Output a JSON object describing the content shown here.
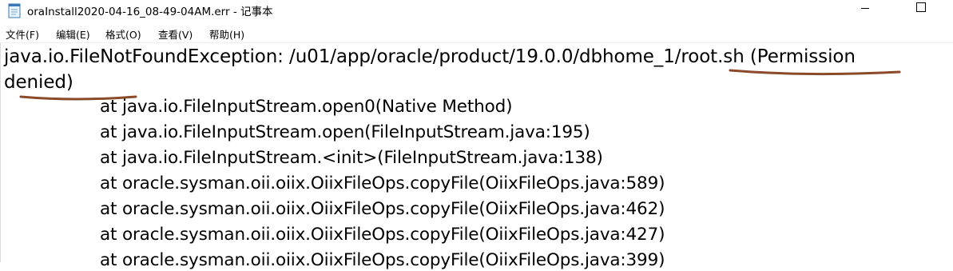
{
  "window": {
    "title": "oraInstall2020-04-16_08-49-04AM.err - 记事本",
    "icon": "notepad-file-icon"
  },
  "menu": {
    "file": "文件(F)",
    "edit": "编辑(E)",
    "format": "格式(O)",
    "view": "查看(V)",
    "help": "帮助(H)"
  },
  "content": {
    "line1": "java.io.FileNotFoundException: /u01/app/oracle/product/19.0.0/dbhome_1/root.sh (Permission",
    "line2": "denied)",
    "stack": [
      "at java.io.FileInputStream.open0(Native Method)",
      "at java.io.FileInputStream.open(FileInputStream.java:195)",
      "at java.io.FileInputStream.<init>(FileInputStream.java:138)",
      "at oracle.sysman.oii.oiix.OiixFileOps.copyFile(OiixFileOps.java:589)",
      "at oracle.sysman.oii.oiix.OiixFileOps.copyFile(OiixFileOps.java:462)",
      "at oracle.sysman.oii.oiix.OiixFileOps.copyFile(OiixFileOps.java:427)",
      "at oracle.sysman.oii.oiix.OiixFileOps.copyFile(OiixFileOps.java:399)"
    ]
  },
  "annotation": {
    "color": "#8b4a2a"
  }
}
